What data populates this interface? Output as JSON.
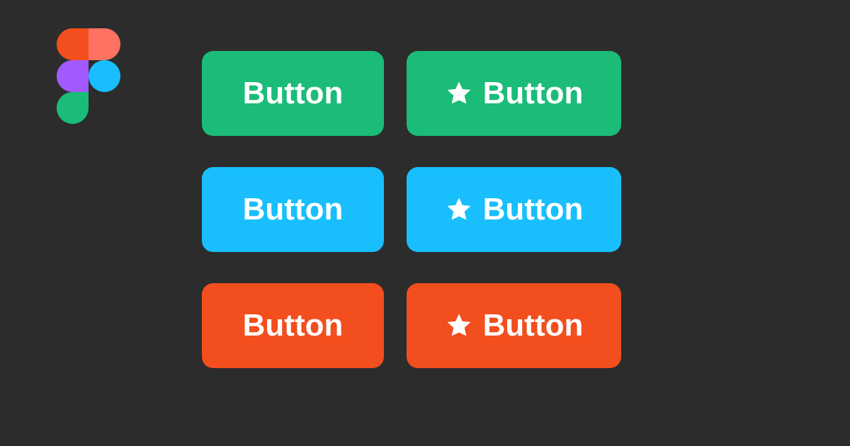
{
  "buttons": {
    "rows": [
      {
        "plain": {
          "label": "Button"
        },
        "icon": {
          "label": "Button",
          "icon": "star-icon"
        }
      },
      {
        "plain": {
          "label": "Button"
        },
        "icon": {
          "label": "Button",
          "icon": "star-icon"
        }
      },
      {
        "plain": {
          "label": "Button"
        },
        "icon": {
          "label": "Button",
          "icon": "star-icon"
        }
      }
    ]
  },
  "colors": {
    "background": "#2c2c2c",
    "green": "#1abc78",
    "blue": "#18bffc",
    "red": "#f24e1e",
    "purple": "#a259ff",
    "orange_light": "#ff7262",
    "text": "#ffffff"
  }
}
